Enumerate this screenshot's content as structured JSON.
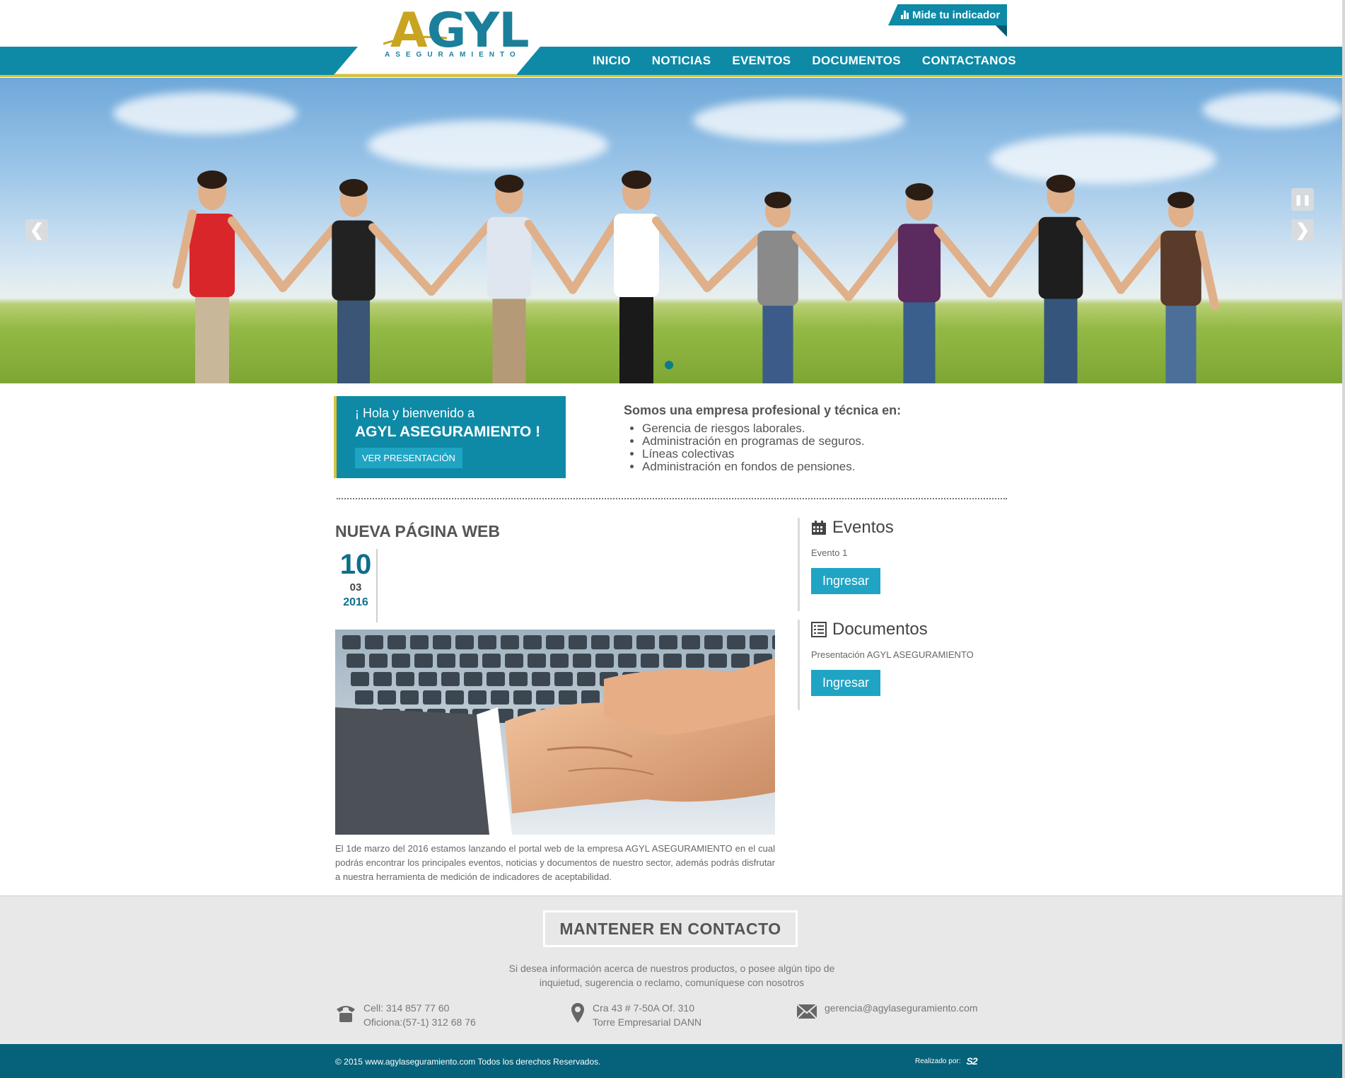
{
  "brand": {
    "name": "AGYL",
    "subtitle": "ASEGURAMIENTO",
    "accent_color": "#0e8aa7",
    "gold_color": "#d6c23d"
  },
  "header": {
    "indicator_button": "Mide tu indicador",
    "nav": [
      "INICIO",
      "NOTICIAS",
      "EVENTOS",
      "DOCUMENTOS",
      "CONTACTANOS"
    ]
  },
  "hero": {
    "prev_icon": "chevron-left-icon",
    "next_icon": "chevron-right-icon",
    "pause_icon": "pause-icon",
    "prev_glyph": "❮",
    "next_glyph": "❯",
    "pause_glyph": "❚❚"
  },
  "welcome": {
    "greeting": "¡ Hola y bienvenido a",
    "company": "AGYL ASEGURAMIENTO !",
    "button": "VER PRESENTACIÓN"
  },
  "about": {
    "title": "Somos una empresa profesional y técnica en:",
    "items": [
      "Gerencia de riesgos laborales.",
      "Administración en programas de seguros.",
      "Líneas colectivas",
      "Administración en fondos de pensiones."
    ]
  },
  "article": {
    "title": "NUEVA PÁGINA WEB",
    "date": {
      "day": "10",
      "month": "03",
      "year": "2016"
    },
    "text": "El 1de marzo del 2016 estamos lanzando el portal web de la empresa AGYL ASEGURAMIENTO en el cual podrás encontrar los principales eventos, noticias y documentos de nuestro sector, además podrás disfrutar a nuestra herramienta de medición de indicadores de aceptabilidad."
  },
  "sidebar": {
    "events": {
      "title": "Eventos",
      "item": "Evento 1",
      "button": "Ingresar",
      "icon": "calendar-icon"
    },
    "documents": {
      "title": "Documentos",
      "item": "Presentación AGYL ASEGURAMIENTO",
      "button": "Ingresar",
      "icon": "list-document-icon"
    }
  },
  "footer": {
    "contact_title": "MANTENER EN CONTACTO",
    "message_line1": "Si desea información acerca de nuestros productos, o posee algún tipo de",
    "message_line2": "inquietud, sugerencia o reclamo, comuníquese con nosotros",
    "phone": {
      "line1": "Cell: 314 857 77 60",
      "line2": "Oficiona:(57-1) 312 68 76",
      "icon": "phone-icon"
    },
    "address": {
      "line1": "Cra 43 # 7-50A Of. 310",
      "line2": "Torre Empresarial DANN",
      "icon": "map-pin-icon"
    },
    "email": {
      "line1": "gerencia@agylaseguramiento.com",
      "icon": "envelope-icon"
    },
    "copyright": "© 2015 www.agylaseguramiento.com Todos los derechos Reservados.",
    "credit_label": "Realizado por:",
    "credit_logo": "S2"
  }
}
